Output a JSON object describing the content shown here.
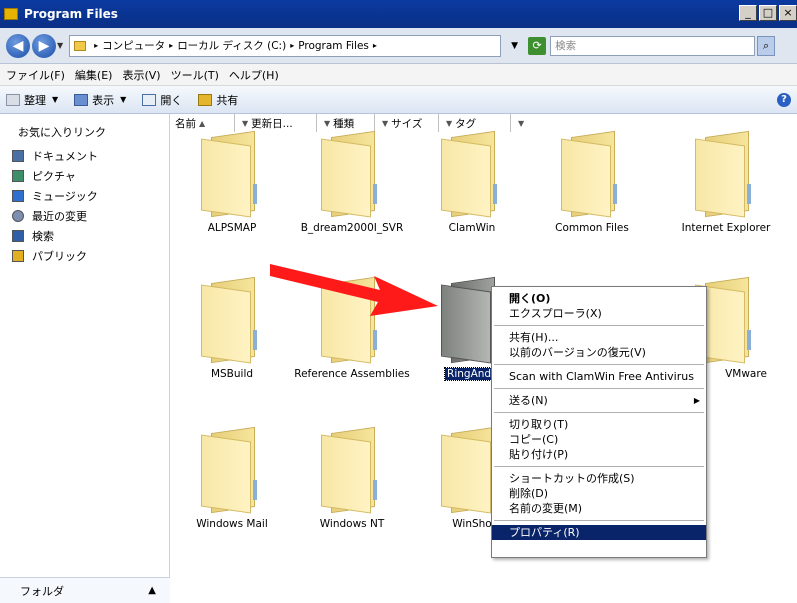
{
  "window": {
    "title": "Program Files",
    "buttons": [
      "_",
      "□",
      "×"
    ]
  },
  "address": {
    "crumbs": [
      "コンピュータ",
      "ローカル ディスク (C:)",
      "Program Files"
    ],
    "search_placeholder": "検索"
  },
  "menu": [
    "ファイル(F)",
    "編集(E)",
    "表示(V)",
    "ツール(T)",
    "ヘルプ(H)"
  ],
  "toolbar": {
    "organize": "整理",
    "view": "表示",
    "open": "開く",
    "share": "共有"
  },
  "sidebar": {
    "title": "お気に入りリンク",
    "items": [
      {
        "label": "ドキュメント",
        "color": "#4a6fa5"
      },
      {
        "label": "ピクチャ",
        "color": "#3c8f6a"
      },
      {
        "label": "ミュージック",
        "color": "#2f6fcf"
      },
      {
        "label": "最近の変更",
        "color": "#7b8fb0"
      },
      {
        "label": "検索",
        "color": "#2f5fa8"
      },
      {
        "label": "パブリック",
        "color": "#e0b020"
      }
    ],
    "folders_label": "フォルダ"
  },
  "columns": [
    "名前",
    "更新日...",
    "種類",
    "サイズ",
    "タグ"
  ],
  "files": [
    "ALPSMAP",
    "B_dream2000I_SVR",
    "ClamWin",
    "Common Files",
    "Internet Explorer",
    "MSBuild",
    "Reference Assemblies",
    "RingAndL",
    "VMware",
    "Windows Mail",
    "Windows NT",
    "WinSho"
  ],
  "context_menu": {
    "open": "開く(O)",
    "explore": "エクスプローラ(X)",
    "share": "共有(H)...",
    "restore": "以前のバージョンの復元(V)",
    "scan": "Scan with ClamWin Free Antivirus",
    "send_to": "送る(N)",
    "cut": "切り取り(T)",
    "copy": "コピー(C)",
    "paste": "貼り付け(P)",
    "create_shortcut": "ショートカットの作成(S)",
    "delete": "削除(D)",
    "rename": "名前の変更(M)",
    "properties": "プロパティ(R)"
  },
  "colors": {
    "highlight": "#0a246a",
    "annotation_arrow": "#ff1a1a"
  }
}
